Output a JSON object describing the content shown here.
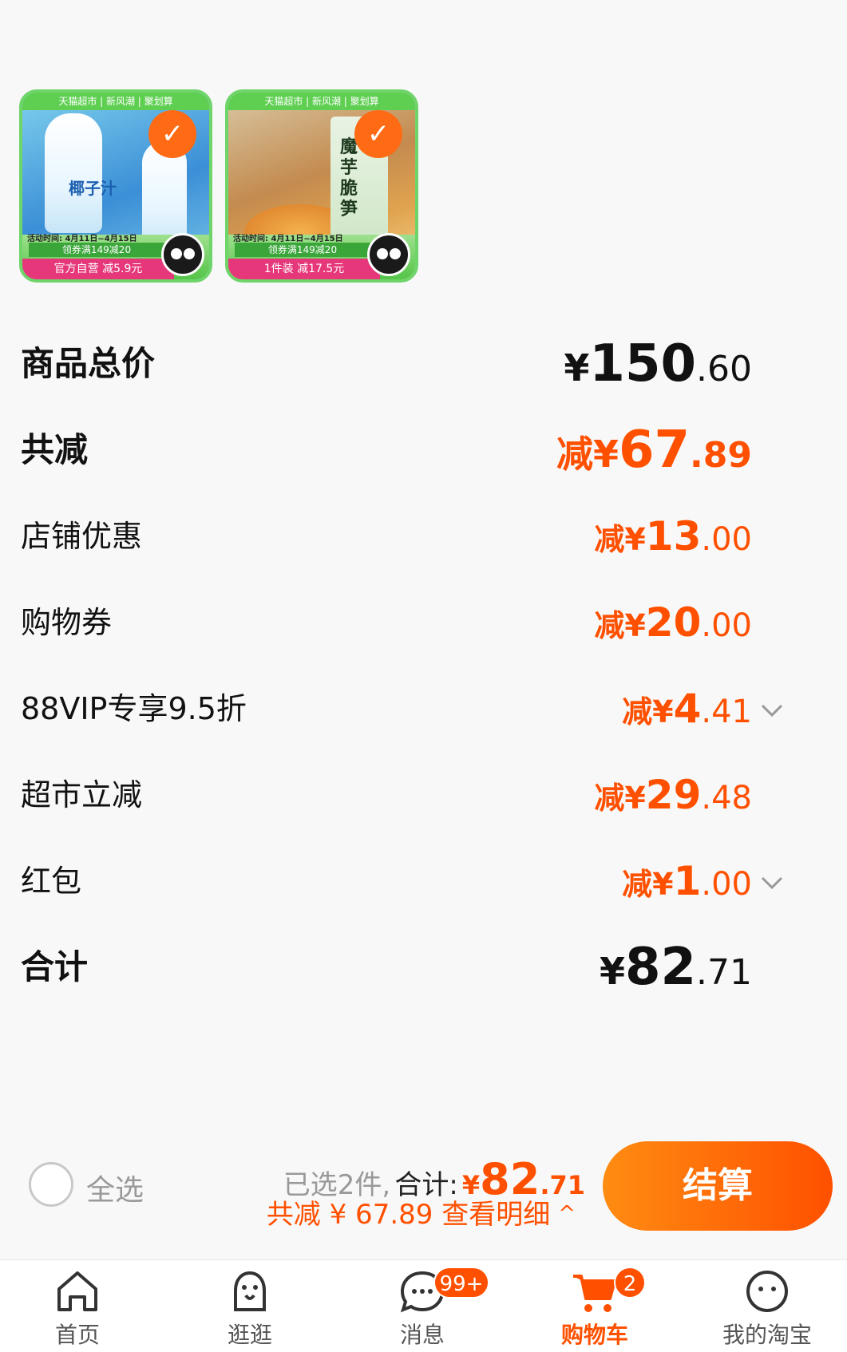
{
  "products": [
    {
      "top_band": "天猫超市 | 新风潮 | 聚划算",
      "name_text": "椰子汁",
      "date_text": "活动时间: 4月11日~4月15日",
      "coupon_text": "领券满149减20",
      "deal_text": "官方自营 减5.9元",
      "selected": true
    },
    {
      "top_band": "天猫超市 | 新风潮 | 聚划算",
      "name_text": "魔芋脆笋",
      "date_text": "活动时间: 4月11日~4月15日",
      "coupon_text": "领券满149减20",
      "deal_text": "1件装 减17.5元",
      "selected": true
    }
  ],
  "summary": [
    {
      "label": "商品总价",
      "prefix": "¥",
      "int": "150",
      "dec": ".60",
      "style": "total"
    },
    {
      "label": "共减",
      "prefix": "减¥",
      "int": "67",
      "dec": ".89",
      "style": "discount-main"
    },
    {
      "label": "店铺优惠",
      "prefix": "减¥",
      "int": "13",
      "dec": ".00",
      "style": "discount"
    },
    {
      "label": "购物券",
      "prefix": "减¥",
      "int": "20",
      "dec": ".00",
      "style": "discount"
    },
    {
      "label": "88VIP专享9.5折",
      "prefix": "减¥",
      "int": "4",
      "dec": ".41",
      "style": "discount",
      "expandable": true
    },
    {
      "label": "超市立减",
      "prefix": "减¥",
      "int": "29",
      "dec": ".48",
      "style": "discount"
    },
    {
      "label": "红包",
      "prefix": "减¥",
      "int": "1",
      "dec": ".00",
      "style": "discount",
      "expandable": true
    },
    {
      "label": "合计",
      "prefix": "¥",
      "int": "82",
      "dec": ".71",
      "style": "total"
    }
  ],
  "bottom_bar": {
    "select_all_label": "全选",
    "selected_count_text": "已选2件,",
    "total_label": "合计:",
    "total_yen": "¥",
    "total_int": "82",
    "total_dec": ".71",
    "discount_text": "共减 ¥ 67.89 查看明细",
    "detail_caret": "^",
    "checkout_label": "结算"
  },
  "tabbar": {
    "tabs": [
      {
        "label": "首页",
        "icon": "home-icon"
      },
      {
        "label": "逛逛",
        "icon": "browse-icon"
      },
      {
        "label": "消息",
        "icon": "message-icon",
        "badge": "99+"
      },
      {
        "label": "购物车",
        "icon": "cart-icon",
        "badge": "2",
        "active": true
      },
      {
        "label": "我的淘宝",
        "icon": "profile-icon"
      }
    ]
  },
  "colors": {
    "accent": "#ff5000",
    "accent_gradient_start": "#ff8c12",
    "background": "#f8f8f8",
    "text": "#111111",
    "muted": "#999999"
  }
}
